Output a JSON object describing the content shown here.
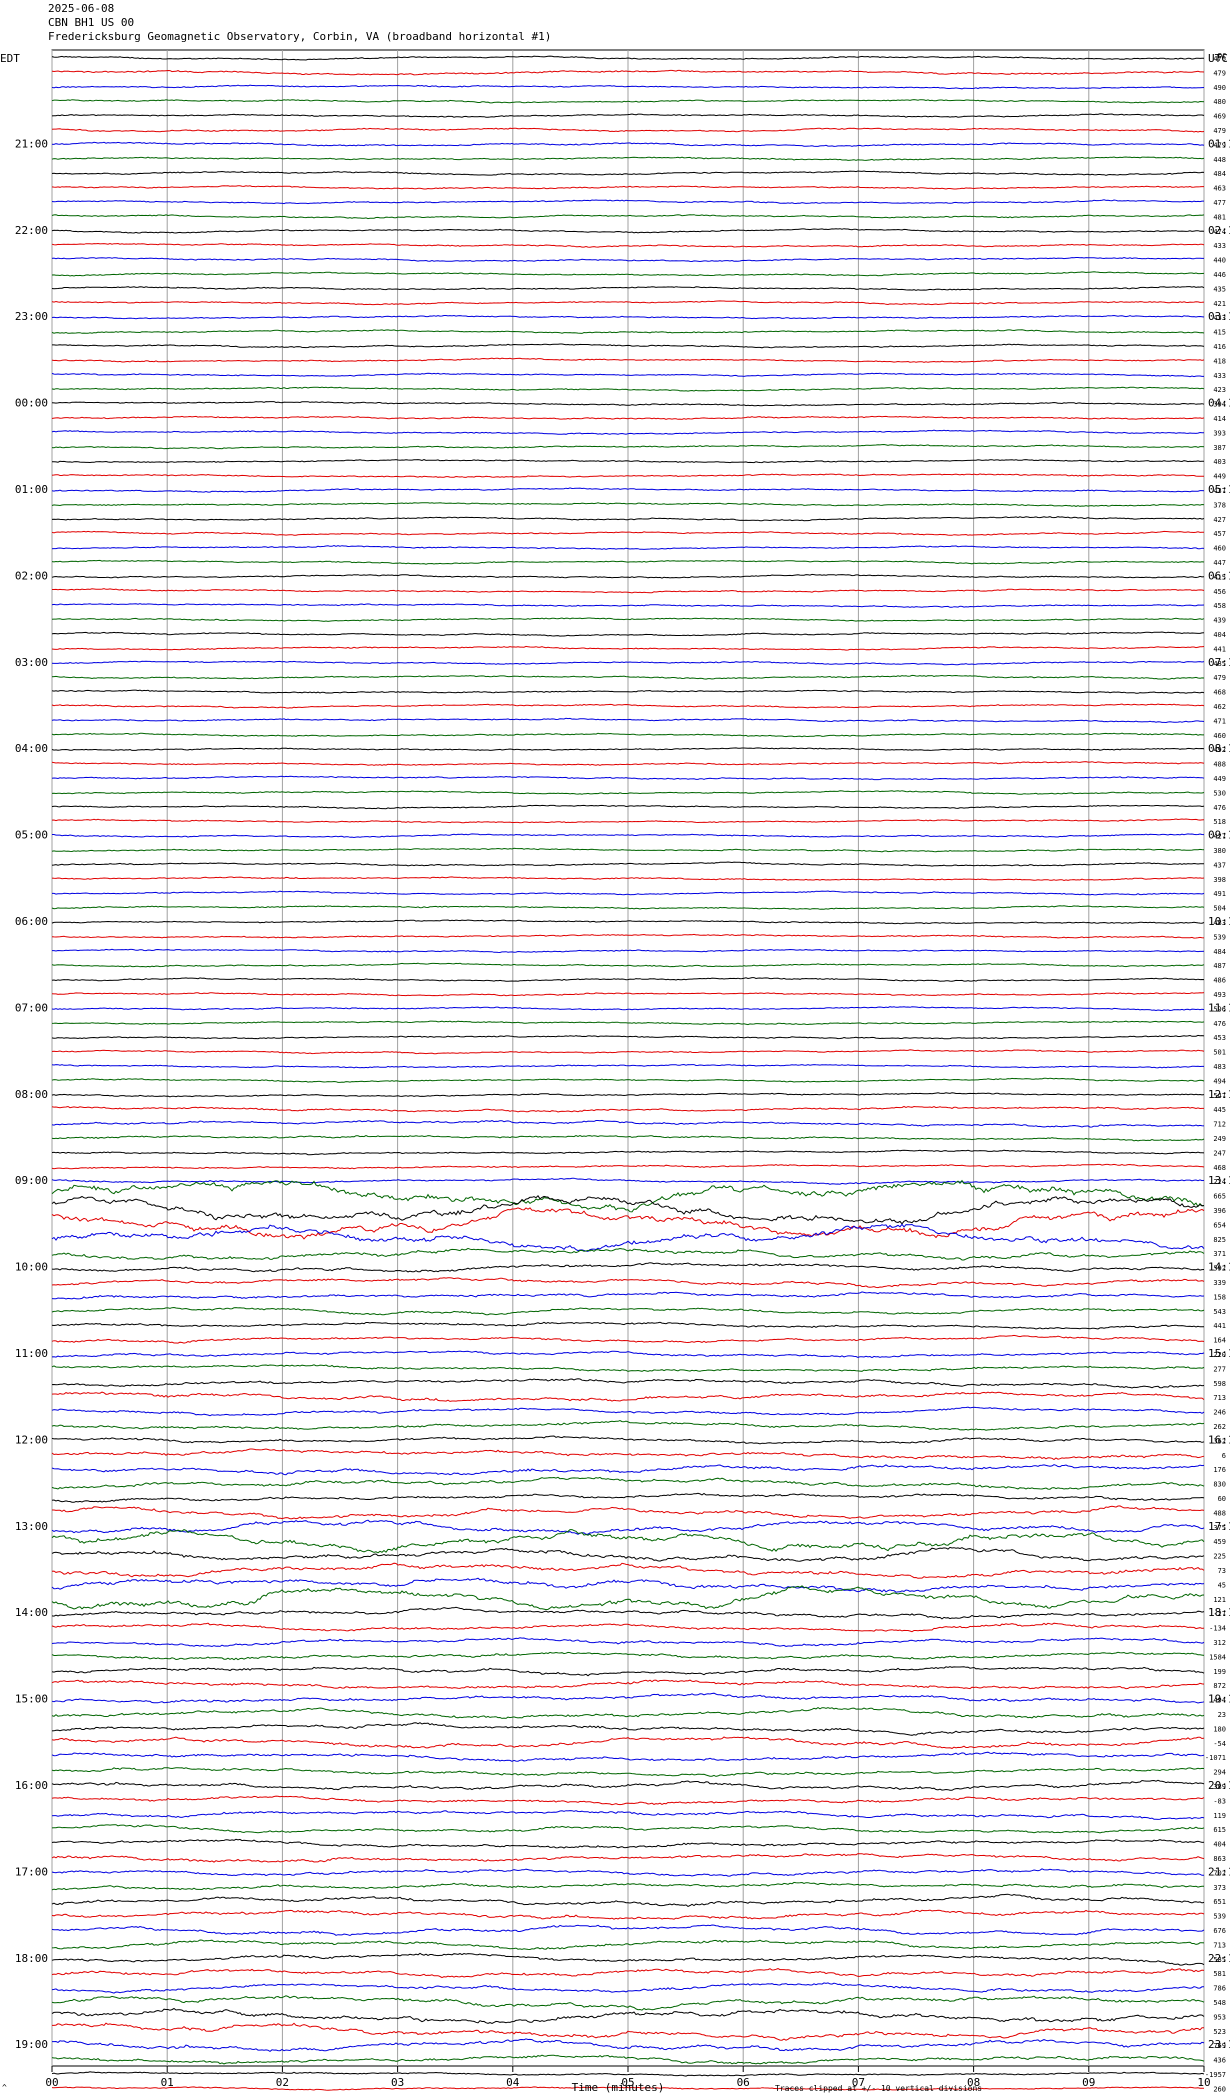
{
  "header": {
    "date": "2025-06-08",
    "station": "CBN BH1 US 00",
    "observatory": "Fredericksburg Geomagnetic Observatory, Corbin, VA (broadband horizontal #1)"
  },
  "left_zone_label": "EDT",
  "right_zone_label": "UTC",
  "right_column_header": "DC",
  "footer": {
    "x_axis_title": "Time (minutes)",
    "clip_note": "Traces clipped at +/- 10 vertical divisions",
    "corner_mark": "^"
  },
  "colors": {
    "sequence": [
      "#000000",
      "#e00000",
      "#0000e0",
      "#006400"
    ],
    "grid": "#a0a0a0"
  },
  "chart_data": {
    "type": "line",
    "title": "Fredericksburg Geomagnetic Observatory, Corbin, VA (broadband horizontal #1)",
    "xlabel": "Time (minutes)",
    "xlim": [
      0,
      10
    ],
    "x_ticks": [
      "00",
      "01",
      "02",
      "03",
      "04",
      "05",
      "06",
      "07",
      "08",
      "09",
      "10"
    ],
    "rows_per_hour": 6,
    "left_hour_labels": [
      "21:00",
      "22:00",
      "23:00",
      "00:00",
      "01:00",
      "02:00",
      "03:00",
      "04:00",
      "05:00",
      "06:00",
      "07:00",
      "08:00",
      "09:00",
      "10:00",
      "11:00",
      "12:00",
      "13:00",
      "14:00",
      "15:00",
      "16:00",
      "17:00",
      "18:00",
      "19:00"
    ],
    "right_hour_labels": [
      "01:10",
      "02:10",
      "03:10",
      "04:10",
      "05:10",
      "06:10",
      "07:10",
      "08:10",
      "09:10",
      "10:10",
      "11:10",
      "12:10",
      "13:10",
      "14:10",
      "15:10",
      "16:10",
      "17:10",
      "18:10",
      "19:10",
      "20:10",
      "21:10",
      "22:10",
      "23:10"
    ],
    "dc_offsets": [
      "476",
      "479",
      "490",
      "480",
      "469",
      "479",
      "479",
      "448",
      "484",
      "463",
      "477",
      "481",
      "474",
      "433",
      "440",
      "446",
      "435",
      "421",
      "433",
      "415",
      "416",
      "418",
      "433",
      "423",
      "394",
      "414",
      "393",
      "387",
      "403",
      "449",
      "437",
      "378",
      "427",
      "457",
      "460",
      "447",
      "415",
      "456",
      "458",
      "439",
      "404",
      "441",
      "485",
      "479",
      "468",
      "462",
      "471",
      "460",
      "492",
      "488",
      "449",
      "530",
      "476",
      "518",
      "427",
      "380",
      "437",
      "398",
      "491",
      "504",
      "483",
      "539",
      "484",
      "487",
      "486",
      "493",
      "596",
      "476",
      "453",
      "501",
      "483",
      "494",
      "547",
      "445",
      "712",
      "249",
      "247",
      "468",
      "224",
      "665",
      "396",
      "654",
      "825",
      "371",
      "592",
      "339",
      "158",
      "543",
      "441",
      "164",
      "220",
      "277",
      "598",
      "713",
      "246",
      "262",
      "362",
      "6",
      "176",
      "830",
      "60",
      "488",
      "375",
      "459",
      "225",
      "73",
      "45",
      "121",
      "-27",
      "-134",
      "312",
      "1584",
      "199",
      "872",
      "494",
      "23",
      "180",
      "-54",
      "-1071",
      "294",
      "389",
      "-83",
      "119",
      "615",
      "404",
      "863",
      "702",
      "373",
      "651",
      "539",
      "676",
      "713",
      "585",
      "581",
      "786",
      "548",
      "953",
      "523",
      "769",
      "436",
      "-1957",
      "260",
      "339"
    ],
    "activity_level": [
      1,
      1.4,
      1,
      1,
      1,
      1.1,
      1.2,
      1,
      1,
      1,
      1,
      1,
      1,
      1,
      1,
      1,
      1,
      1,
      1,
      1,
      1,
      1,
      1,
      1,
      1,
      1,
      1,
      1,
      1,
      1,
      1,
      1,
      1,
      1,
      1,
      1,
      1,
      1,
      1,
      1,
      1,
      1,
      1,
      1,
      1,
      1,
      1,
      1,
      1,
      1,
      1,
      1,
      1,
      1,
      1,
      1,
      1,
      1,
      1,
      1,
      1,
      1,
      1,
      1,
      1,
      1,
      1,
      1,
      1,
      1,
      1,
      1,
      1,
      1.6,
      1.8,
      1.4,
      1.2,
      1.2,
      1.3,
      10,
      9,
      9,
      8,
      4,
      3,
      2.5,
      2.5,
      2.2,
      2,
      2,
      2,
      2,
      2.5,
      3,
      2.2,
      2.5,
      2.2,
      3,
      3.5,
      3.5,
      2.5,
      3.5,
      4.5,
      7,
      4.5,
      5,
      5,
      7,
      3,
      2.5,
      2.5,
      2.5,
      3,
      3,
      3,
      3,
      3,
      3.5,
      3,
      2.5,
      3,
      2.5,
      2.5,
      2.5,
      2.5,
      3,
      2.5,
      2.5,
      3,
      3,
      3,
      3,
      3,
      3,
      3,
      4,
      5,
      4.5,
      4,
      3
    ],
    "grid": true
  }
}
